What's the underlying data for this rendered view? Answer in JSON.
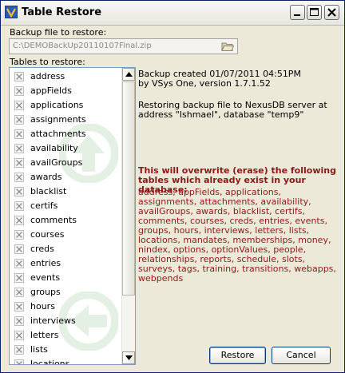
{
  "window": {
    "title": "Table Restore",
    "icon": "app-icon",
    "controls": {
      "minimize": "minimize-icon",
      "maximize": "maximize-icon",
      "close": "close-icon"
    }
  },
  "backup_file": {
    "label": "Backup file to restore:",
    "value": "C:\\DEMOBackUp20110107Final.zip",
    "browse_icon": "folder-open-icon"
  },
  "tables": {
    "label": "Tables to restore:",
    "items": [
      "address",
      "appFields",
      "applications",
      "assignments",
      "attachments",
      "availability",
      "availGroups",
      "awards",
      "blacklist",
      "certifs",
      "comments",
      "courses",
      "creds",
      "entries",
      "events",
      "groups",
      "hours",
      "interviews",
      "letters",
      "lists",
      "locations"
    ]
  },
  "info": {
    "line1": "Backup created 01/07/2011 04:51PM",
    "line2": "by VSys One, version 1.7.1.52",
    "line3": "Restoring backup file to NexusDB server at",
    "line4": "address \"Ishmael\", database \"temp9\""
  },
  "warning": {
    "title": "This will overwrite (erase) the following tables which already exist in your database:",
    "tables": "address, appFields, applications, assignments, attachments, availability, availGroups, awards, blacklist, certifs, comments, courses, creds, entries, events, groups, hours, interviews, letters, lists, locations, mandates, memberships, money, nindex, options, optionValues, people, relationships, reports, schedule, slots, surveys, tags, training, transitions, webapps, webpends"
  },
  "buttons": {
    "restore": "Restore",
    "cancel": "Cancel"
  },
  "colors": {
    "warning_text": "#8a1a1a",
    "title_bar": "#ece9d8",
    "border": "#0a246a"
  }
}
